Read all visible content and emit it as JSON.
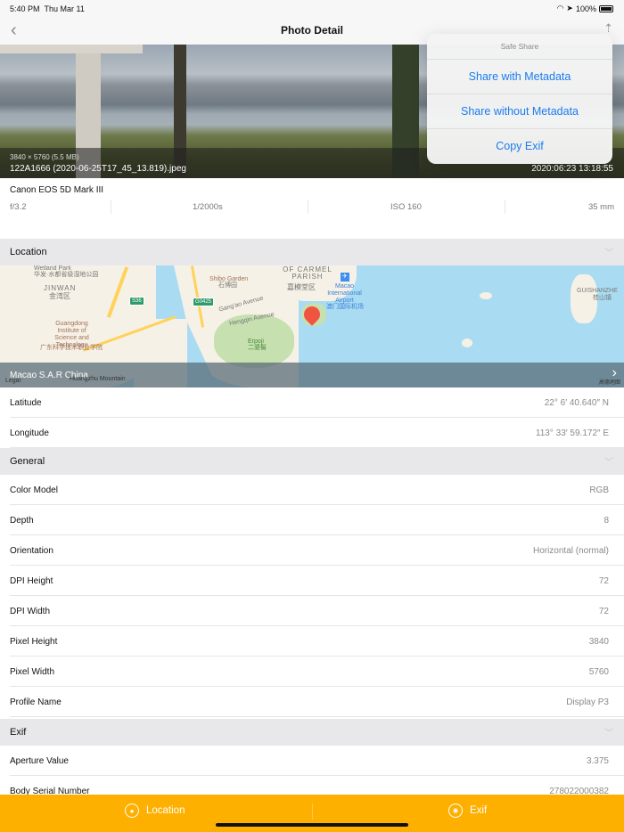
{
  "status": {
    "time": "5:40 PM",
    "date": "Thu Mar 11",
    "battery": "100%"
  },
  "nav": {
    "title": "Photo Detail"
  },
  "photo": {
    "dimensions": "3840 × 5760 (5.5 MB)",
    "filename": "122A1666 (2020-06-25T17_45_13.819).jpeg",
    "date": "2020:06:23 13:18:55"
  },
  "camera": {
    "model": "Canon EOS 5D Mark III",
    "aperture": "f/3.2",
    "shutter": "1/2000s",
    "iso": "ISO 160",
    "focal": "35 mm"
  },
  "popover": {
    "title": "Safe Share",
    "items": [
      "Share with Metadata",
      "Share without Metadata",
      "Copy Exif"
    ]
  },
  "location": {
    "header": "Location",
    "place": "Macao S.A.R China",
    "map_labels": {
      "wetland": "Wetland Park",
      "wetland_cn": "华发·水都省级湿地公园",
      "jinwan": "JINWAN",
      "jinwan_cn": "金湾区",
      "institute": "Guangdong Institute of Science and Technology",
      "institute_cn": "广东科学技术职业学院",
      "carmel": "OF CARMEL PARISH",
      "carmel_cn": "嘉模堂区",
      "shibo": "Shibo Garden",
      "shibo_cn": "石博园",
      "airport": "Macao International Airport",
      "airport_cn": "澳门国际机场",
      "gangao": "Gang'ao Avenue",
      "hengqin": "Hengqin Avenue",
      "erpoji": "Erpoji",
      "erpoji_cn": "二婆髻",
      "guishan": "GUISHANZHE",
      "guishan_cn": "桂山镇",
      "huangzhu": "Huangzhu Mountain",
      "legal": "Legal",
      "gaode": "高德地图",
      "s36": "S36",
      "g0425": "G0425"
    },
    "rows": [
      {
        "k": "Latitude",
        "v": "22° 6′ 40.640″ N"
      },
      {
        "k": "Longitude",
        "v": "113° 33′ 59.172″ E"
      }
    ]
  },
  "general": {
    "header": "General",
    "rows": [
      {
        "k": "Color Model",
        "v": "RGB"
      },
      {
        "k": "Depth",
        "v": "8"
      },
      {
        "k": "Orientation",
        "v": "Horizontal (normal)"
      },
      {
        "k": "DPI Height",
        "v": "72"
      },
      {
        "k": "DPI Width",
        "v": "72"
      },
      {
        "k": "Pixel Height",
        "v": "3840"
      },
      {
        "k": "Pixel Width",
        "v": "5760"
      },
      {
        "k": "Profile Name",
        "v": "Display P3"
      }
    ]
  },
  "exif": {
    "header": "Exif",
    "rows": [
      {
        "k": "Aperture Value",
        "v": "3.375"
      },
      {
        "k": "Body Serial Number",
        "v": "278022000382"
      }
    ]
  },
  "tabbar": {
    "location": "Location",
    "exif": "Exif"
  },
  "colors": {
    "accent": "#fdb000",
    "link": "#1a7cf0"
  }
}
